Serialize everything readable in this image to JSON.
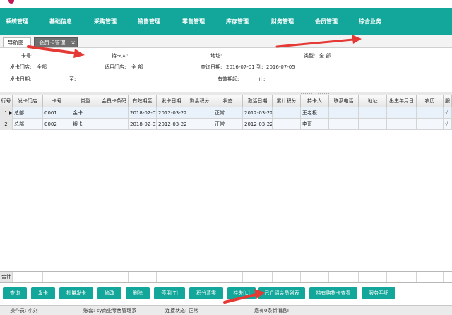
{
  "menu": {
    "items": [
      "系统管理",
      "基础信息",
      "采购管理",
      "销售管理",
      "零售管理",
      "库存管理",
      "财务管理",
      "会员管理",
      "综合业务"
    ]
  },
  "tabs": {
    "nav": "导航图",
    "active": "会员卡管理",
    "close": "×"
  },
  "form": {
    "card_no_label": "卡号:",
    "card_no_value": "",
    "holder_label": "持卡人:",
    "holder_value": "",
    "address_label": "地址:",
    "address_value": "",
    "type_label": "类型:",
    "type_value": "全 部",
    "issue_store_label": "发卡门店:",
    "issue_store_value": "全部",
    "apply_store_label": "适用门店:",
    "apply_store_value": "全 部",
    "query_date_label": "查询日期:",
    "query_date_from": "2016-07-01",
    "query_date_to_label": "到:",
    "query_date_to": "2016-07-05",
    "issue_date_label": "发卡日期:",
    "issue_date_to_label": "至:",
    "valid_from_label": "有效期起:",
    "valid_to_label": "止:"
  },
  "grid": {
    "columns": [
      "行号",
      "发卡门店",
      "卡号",
      "类型",
      "会员卡条码",
      "有效期至",
      "发卡日期",
      "剩余积分",
      "状态",
      "激活日期",
      "累计积分",
      "持卡人",
      "联系电话",
      "地址",
      "出生年月日",
      "农历",
      "服"
    ],
    "rows": [
      [
        "1",
        "总部",
        "0001",
        "金卡",
        "",
        "2018-02-02",
        "2012-03-22",
        "",
        "正常",
        "2012-03-22",
        "",
        "王老板",
        "",
        "",
        "",
        "",
        "√"
      ],
      [
        "2",
        "总部",
        "0002",
        "银卡",
        "",
        "2018-02-02",
        "2012-03-22",
        "",
        "正常",
        "2012-03-22",
        "",
        "李哥",
        "",
        "",
        "",
        "",
        "√"
      ]
    ],
    "total_label": "合计"
  },
  "buttons": [
    "查询",
    "发卡",
    "批量发卡",
    "修改",
    "删除",
    "停用[T]",
    "积分清零",
    "挂失[L]",
    "已介绍会员列表",
    "持有购物卡查看",
    "服务明细"
  ],
  "status": {
    "operator": "操作员: 小刘",
    "account": "账套: sy商业零售管理系",
    "connection": "连接状态: 正常",
    "messages": "您有0条新消息!"
  },
  "colors": {
    "accent": "#12a79a",
    "annotation_arrow": "#e53935"
  }
}
